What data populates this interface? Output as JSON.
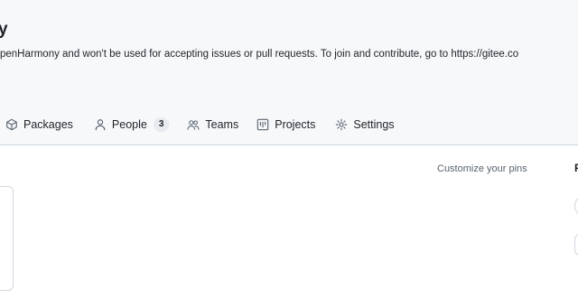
{
  "header": {
    "title_fragment": "y",
    "description": "penHarmony and won't be used for accepting issues or pull requests. To join and contribute, go to https://gitee.co"
  },
  "nav": {
    "items": [
      {
        "label": "Packages",
        "icon": "package-icon"
      },
      {
        "label": "People",
        "icon": "person-icon",
        "count": "3"
      },
      {
        "label": "Teams",
        "icon": "people-icon"
      },
      {
        "label": "Projects",
        "icon": "table-icon"
      },
      {
        "label": "Settings",
        "icon": "gear-icon"
      }
    ]
  },
  "pins": {
    "customize_label": "Customize your pins"
  },
  "right_panel": {
    "heading_fragment": "P"
  },
  "colors": {
    "header_bg": "#f6f8fa",
    "border": "#d0d7de",
    "muted_text": "#59636e",
    "counter_bg": "#e7eaee"
  }
}
